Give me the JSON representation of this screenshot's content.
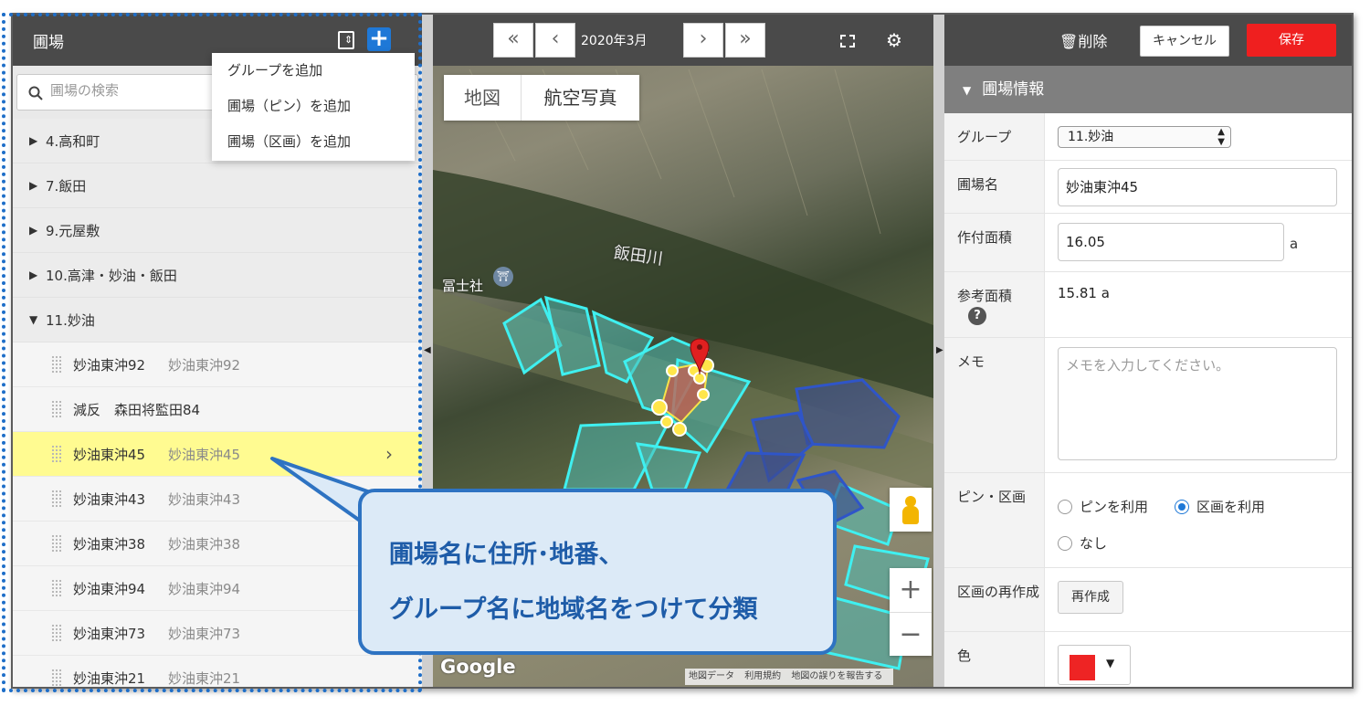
{
  "left": {
    "title": "圃場",
    "search_placeholder": "圃場の検索",
    "menu": [
      "グループを追加",
      "圃場（ピン）を追加",
      "圃場（区画）を追加"
    ],
    "groups": [
      {
        "label": "4.高和町",
        "expanded": false
      },
      {
        "label": "7.飯田",
        "expanded": false
      },
      {
        "label": "9.元屋敷",
        "expanded": false
      },
      {
        "label": "10.高津・妙油・飯田",
        "expanded": false
      },
      {
        "label": "11.妙油",
        "expanded": true
      }
    ],
    "fields": [
      {
        "name": "妙油東沖92",
        "sub": "妙油東沖92"
      },
      {
        "name": "減反　森田将監田84",
        "sub": ""
      },
      {
        "name": "妙油東沖45",
        "sub": "妙油東沖45",
        "selected": true
      },
      {
        "name": "妙油東沖43",
        "sub": "妙油東沖43"
      },
      {
        "name": "妙油東沖38",
        "sub": "妙油東沖38"
      },
      {
        "name": "妙油東沖94",
        "sub": "妙油東沖94"
      },
      {
        "name": "妙油東沖73",
        "sub": "妙油東沖73"
      },
      {
        "name": "妙油東沖21",
        "sub": "妙油東沖21"
      }
    ]
  },
  "map": {
    "date": "2020年3月",
    "type_map": "地図",
    "type_aerial": "航空写真",
    "river_label": "飯田川",
    "shrine_label": "冨士社",
    "google": "Google",
    "attribution": [
      "地図データ",
      "利用規約",
      "地図の誤りを報告する"
    ]
  },
  "right": {
    "delete": "削除",
    "cancel": "キャンセル",
    "save": "保存",
    "section": "圃場情報",
    "group_label": "グループ",
    "group_value": "11.妙油",
    "name_label": "圃場名",
    "name_value": "妙油東沖45",
    "area_label": "作付面積",
    "area_value": "16.05",
    "area_unit": "a",
    "ref_label": "参考面積",
    "ref_value": "15.81 a",
    "memo_label": "メモ",
    "memo_placeholder": "メモを入力してください。",
    "pin_label": "ピン・区画",
    "radio_pin": "ピンを利用",
    "radio_area": "区画を利用",
    "radio_none": "なし",
    "rebuild_label": "区画の再作成",
    "rebuild_button": "再作成",
    "color_label": "色",
    "color_value": "#ee2424"
  },
  "callout": {
    "line1": "圃場名に住所･地番、",
    "line2": "グループ名に地域名をつけて分類"
  }
}
